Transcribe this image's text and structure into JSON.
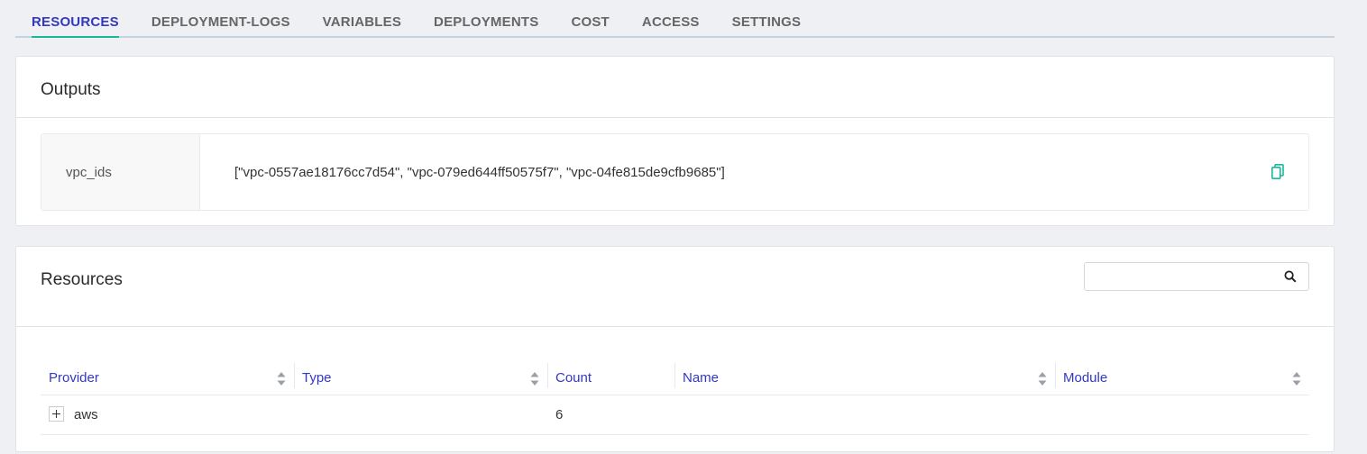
{
  "tabs": [
    {
      "label": "RESOURCES",
      "active": true
    },
    {
      "label": "DEPLOYMENT-LOGS",
      "active": false
    },
    {
      "label": "VARIABLES",
      "active": false
    },
    {
      "label": "DEPLOYMENTS",
      "active": false
    },
    {
      "label": "COST",
      "active": false
    },
    {
      "label": "ACCESS",
      "active": false
    },
    {
      "label": "SETTINGS",
      "active": false
    }
  ],
  "outputs": {
    "title": "Outputs",
    "items": [
      {
        "key": "vpc_ids",
        "value": "[\"vpc-0557ae18176cc7d54\", \"vpc-079ed644ff50575f7\", \"vpc-04fe815de9cfb9685\"]",
        "icon": "copy-icon"
      }
    ]
  },
  "resources": {
    "title": "Resources",
    "search": {
      "placeholder": "",
      "value": "",
      "icon": "search-icon"
    },
    "columns": [
      {
        "label": "Provider",
        "sortable": true
      },
      {
        "label": "Type",
        "sortable": true
      },
      {
        "label": "Count",
        "sortable": false
      },
      {
        "label": "Name",
        "sortable": true
      },
      {
        "label": "Module",
        "sortable": true
      }
    ],
    "rows": [
      {
        "provider": "aws",
        "type": "",
        "count": "6",
        "name": "",
        "module": ""
      }
    ]
  },
  "colors": {
    "accent": "#3338c4",
    "tab_underline": "#18b99a",
    "copy_icon": "#18b99a"
  }
}
